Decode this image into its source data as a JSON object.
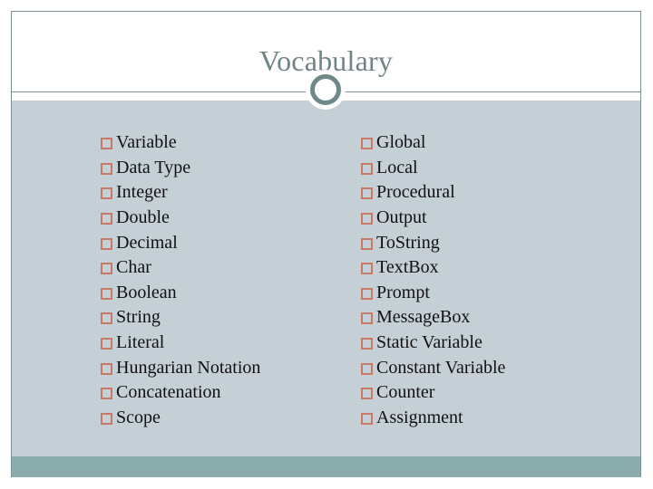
{
  "slide": {
    "title": "Vocabulary",
    "colors": {
      "title": "#6f8585",
      "panel": "#c5d0d6",
      "bottom_bar": "#8aacac",
      "ring": "#6f8888",
      "bullet": "#c97a66",
      "frame": "#7f8f8f"
    },
    "bullet_icon": "square-bullet-icon",
    "left_column": [
      "Variable",
      "Data Type",
      "Integer",
      "Double",
      "Decimal",
      "Char",
      "Boolean",
      "String",
      "Literal",
      "Hungarian Notation",
      "Concatenation",
      "Scope"
    ],
    "right_column": [
      "Global",
      "Local",
      "Procedural",
      "Output",
      "ToString",
      "TextBox",
      "Prompt",
      "MessageBox",
      "Static Variable",
      "Constant Variable",
      "Counter",
      "Assignment"
    ]
  }
}
